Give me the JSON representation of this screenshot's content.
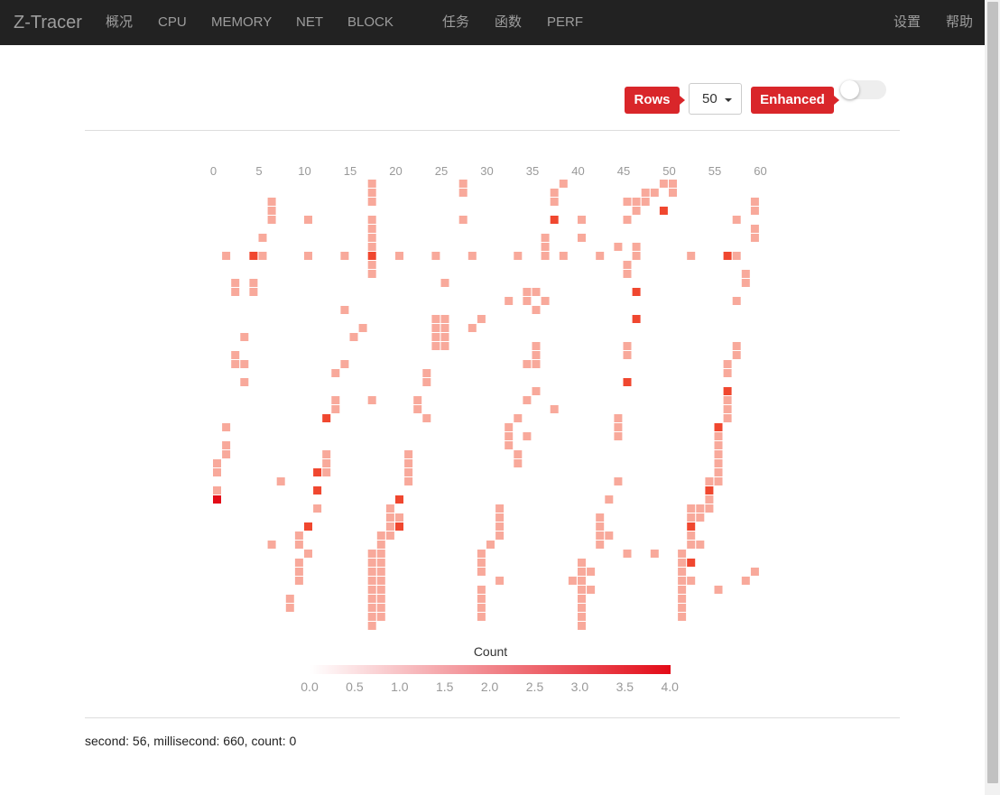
{
  "navbar": {
    "brand": "Z-Tracer",
    "items": [
      "概况",
      "CPU",
      "MEMORY",
      "NET",
      "BLOCK",
      "任务",
      "函数",
      "PERF"
    ],
    "right_items": [
      "设置",
      "帮助"
    ]
  },
  "controls": {
    "rows_label": "Rows",
    "rows_value": "50",
    "enhanced_label": "Enhanced",
    "enhanced_on": false
  },
  "chart_data": {
    "type": "heatmap",
    "x_ticks": [
      "0",
      "5",
      "10",
      "15",
      "20",
      "25",
      "30",
      "35",
      "40",
      "45",
      "50",
      "55",
      "60"
    ],
    "x_range": [
      0,
      60
    ],
    "rows": 50,
    "visual_map": {
      "title": "Count",
      "min": 0,
      "max": 4,
      "labels": [
        "0.0",
        "0.5",
        "1.0",
        "1.5",
        "2.0",
        "2.5",
        "3.0",
        "3.5",
        "4.0"
      ],
      "colors": [
        "#ffffff",
        "#e30b17"
      ]
    },
    "cells": [
      [
        0,
        31,
        1
      ],
      [
        0,
        32,
        1
      ],
      [
        0,
        34,
        1
      ],
      [
        0,
        35,
        4
      ],
      [
        1,
        27,
        1
      ],
      [
        1,
        29,
        1
      ],
      [
        1,
        30,
        1
      ],
      [
        1,
        8,
        1
      ],
      [
        2,
        11,
        1
      ],
      [
        2,
        12,
        1
      ],
      [
        2,
        19,
        1
      ],
      [
        2,
        20,
        1
      ],
      [
        3,
        17,
        1
      ],
      [
        3,
        20,
        1
      ],
      [
        3,
        22,
        1
      ],
      [
        4,
        8,
        2
      ],
      [
        4,
        11,
        1
      ],
      [
        4,
        12,
        1
      ],
      [
        5,
        8,
        1
      ],
      [
        5,
        6,
        1
      ],
      [
        6,
        2,
        1
      ],
      [
        6,
        3,
        1
      ],
      [
        6,
        4,
        1
      ],
      [
        6,
        40,
        1
      ],
      [
        7,
        33,
        1
      ],
      [
        8,
        46,
        1
      ],
      [
        8,
        47,
        1
      ],
      [
        9,
        42,
        1
      ],
      [
        9,
        43,
        1
      ],
      [
        9,
        44,
        1
      ],
      [
        9,
        39,
        1
      ],
      [
        9,
        40,
        1
      ],
      [
        10,
        38,
        2
      ],
      [
        10,
        41,
        1
      ],
      [
        10,
        4,
        1
      ],
      [
        10,
        8,
        1
      ],
      [
        11,
        32,
        2
      ],
      [
        11,
        34,
        2
      ],
      [
        11,
        36,
        1
      ],
      [
        12,
        26,
        2
      ],
      [
        12,
        30,
        1
      ],
      [
        12,
        31,
        1
      ],
      [
        12,
        32,
        1
      ],
      [
        13,
        21,
        1
      ],
      [
        13,
        24,
        1
      ],
      [
        13,
        25,
        1
      ],
      [
        14,
        20,
        1
      ],
      [
        14,
        14,
        1
      ],
      [
        14,
        8,
        1
      ],
      [
        15,
        17,
        1
      ],
      [
        16,
        16,
        1
      ],
      [
        17,
        0,
        1
      ],
      [
        17,
        1,
        1
      ],
      [
        17,
        2,
        1
      ],
      [
        17,
        4,
        1
      ],
      [
        17,
        5,
        1
      ],
      [
        17,
        6,
        1
      ],
      [
        17,
        7,
        1
      ],
      [
        17,
        8,
        2
      ],
      [
        17,
        9,
        1
      ],
      [
        17,
        10,
        1
      ],
      [
        17,
        24,
        1
      ],
      [
        17,
        41,
        1
      ],
      [
        17,
        42,
        1
      ],
      [
        17,
        43,
        1
      ],
      [
        17,
        44,
        1
      ],
      [
        17,
        45,
        1
      ],
      [
        17,
        46,
        1
      ],
      [
        17,
        47,
        1
      ],
      [
        17,
        48,
        1
      ],
      [
        17,
        49,
        1
      ],
      [
        18,
        39,
        1
      ],
      [
        18,
        40,
        1
      ],
      [
        18,
        41,
        1
      ],
      [
        18,
        42,
        1
      ],
      [
        18,
        43,
        1
      ],
      [
        18,
        44,
        1
      ],
      [
        18,
        45,
        1
      ],
      [
        18,
        46,
        1
      ],
      [
        18,
        47,
        1
      ],
      [
        18,
        48,
        1
      ],
      [
        19,
        38,
        1
      ],
      [
        19,
        36,
        1
      ],
      [
        19,
        37,
        1
      ],
      [
        19,
        39,
        1
      ],
      [
        20,
        35,
        2
      ],
      [
        20,
        37,
        1
      ],
      [
        20,
        38,
        2
      ],
      [
        20,
        8,
        1
      ],
      [
        21,
        30,
        1
      ],
      [
        21,
        31,
        1
      ],
      [
        21,
        32,
        1
      ],
      [
        21,
        33,
        1
      ],
      [
        22,
        25,
        1
      ],
      [
        22,
        24,
        1
      ],
      [
        23,
        22,
        1
      ],
      [
        23,
        21,
        1
      ],
      [
        23,
        26,
        1
      ],
      [
        24,
        8,
        1
      ],
      [
        24,
        15,
        1
      ],
      [
        24,
        16,
        1
      ],
      [
        24,
        17,
        1
      ],
      [
        24,
        18,
        1
      ],
      [
        25,
        11,
        1
      ],
      [
        25,
        15,
        1
      ],
      [
        25,
        16,
        1
      ],
      [
        25,
        17,
        1
      ],
      [
        25,
        18,
        1
      ],
      [
        27,
        0,
        1
      ],
      [
        27,
        1,
        1
      ],
      [
        27,
        4,
        1
      ],
      [
        28,
        8,
        1
      ],
      [
        28,
        16,
        1
      ],
      [
        29,
        15,
        1
      ],
      [
        29,
        41,
        1
      ],
      [
        29,
        42,
        1
      ],
      [
        29,
        43,
        1
      ],
      [
        29,
        45,
        1
      ],
      [
        29,
        46,
        1
      ],
      [
        29,
        47,
        1
      ],
      [
        29,
        48,
        1
      ],
      [
        30,
        40,
        1
      ],
      [
        31,
        39,
        1
      ],
      [
        31,
        44,
        1
      ],
      [
        31,
        36,
        1
      ],
      [
        31,
        37,
        1
      ],
      [
        31,
        38,
        1
      ],
      [
        32,
        13,
        1
      ],
      [
        32,
        27,
        1
      ],
      [
        32,
        28,
        1
      ],
      [
        32,
        29,
        1
      ],
      [
        33,
        8,
        1
      ],
      [
        33,
        26,
        1
      ],
      [
        33,
        30,
        1
      ],
      [
        33,
        31,
        1
      ],
      [
        34,
        12,
        1
      ],
      [
        34,
        13,
        1
      ],
      [
        34,
        20,
        1
      ],
      [
        34,
        24,
        1
      ],
      [
        34,
        28,
        1
      ],
      [
        35,
        12,
        1
      ],
      [
        35,
        18,
        1
      ],
      [
        35,
        19,
        1
      ],
      [
        35,
        20,
        1
      ],
      [
        35,
        23,
        1
      ],
      [
        35,
        14,
        1
      ],
      [
        36,
        6,
        1
      ],
      [
        36,
        7,
        1
      ],
      [
        36,
        8,
        1
      ],
      [
        36,
        13,
        1
      ],
      [
        37,
        1,
        1
      ],
      [
        37,
        2,
        1
      ],
      [
        37,
        4,
        2
      ],
      [
        37,
        25,
        1
      ],
      [
        38,
        0,
        1
      ],
      [
        38,
        8,
        1
      ],
      [
        39,
        44,
        1
      ],
      [
        40,
        4,
        1
      ],
      [
        40,
        6,
        1
      ],
      [
        40,
        42,
        1
      ],
      [
        40,
        43,
        1
      ],
      [
        40,
        44,
        1
      ],
      [
        40,
        45,
        1
      ],
      [
        40,
        46,
        1
      ],
      [
        40,
        47,
        1
      ],
      [
        40,
        48,
        1
      ],
      [
        40,
        49,
        1
      ],
      [
        40,
        43,
        1
      ],
      [
        41,
        43,
        1
      ],
      [
        41,
        45,
        1
      ],
      [
        42,
        8,
        1
      ],
      [
        42,
        37,
        1
      ],
      [
        42,
        38,
        1
      ],
      [
        42,
        39,
        1
      ],
      [
        42,
        40,
        1
      ],
      [
        43,
        35,
        1
      ],
      [
        43,
        39,
        1
      ],
      [
        44,
        7,
        1
      ],
      [
        44,
        26,
        1
      ],
      [
        44,
        27,
        1
      ],
      [
        44,
        28,
        1
      ],
      [
        44,
        33,
        1
      ],
      [
        45,
        22,
        2
      ],
      [
        45,
        18,
        1
      ],
      [
        45,
        19,
        1
      ],
      [
        45,
        2,
        1
      ],
      [
        45,
        4,
        1
      ],
      [
        45,
        9,
        1
      ],
      [
        45,
        10,
        1
      ],
      [
        45,
        41,
        1
      ],
      [
        46,
        2,
        1
      ],
      [
        46,
        3,
        1
      ],
      [
        46,
        7,
        1
      ],
      [
        46,
        8,
        1
      ],
      [
        46,
        12,
        2
      ],
      [
        46,
        15,
        2
      ],
      [
        46,
        3,
        1
      ],
      [
        47,
        1,
        1
      ],
      [
        47,
        2,
        1
      ],
      [
        48,
        1,
        1
      ],
      [
        48,
        41,
        1
      ],
      [
        49,
        3,
        2
      ],
      [
        49,
        0,
        1
      ],
      [
        50,
        0,
        1
      ],
      [
        50,
        1,
        1
      ],
      [
        51,
        41,
        1
      ],
      [
        51,
        42,
        1
      ],
      [
        51,
        43,
        1
      ],
      [
        51,
        44,
        1
      ],
      [
        51,
        45,
        1
      ],
      [
        51,
        46,
        1
      ],
      [
        51,
        47,
        1
      ],
      [
        51,
        48,
        1
      ],
      [
        52,
        8,
        1
      ],
      [
        52,
        36,
        1
      ],
      [
        52,
        37,
        1
      ],
      [
        52,
        38,
        2
      ],
      [
        52,
        39,
        1
      ],
      [
        52,
        40,
        1
      ],
      [
        52,
        42,
        2
      ],
      [
        52,
        44,
        1
      ],
      [
        53,
        37,
        1
      ],
      [
        53,
        36,
        1
      ],
      [
        53,
        40,
        1
      ],
      [
        54,
        33,
        1
      ],
      [
        54,
        34,
        2
      ],
      [
        54,
        35,
        1
      ],
      [
        54,
        36,
        1
      ],
      [
        55,
        28,
        1
      ],
      [
        55,
        29,
        1
      ],
      [
        55,
        30,
        1
      ],
      [
        55,
        31,
        1
      ],
      [
        55,
        32,
        1
      ],
      [
        55,
        33,
        1
      ],
      [
        55,
        27,
        2
      ],
      [
        55,
        45,
        1
      ],
      [
        56,
        23,
        2
      ],
      [
        56,
        24,
        1
      ],
      [
        56,
        25,
        1
      ],
      [
        56,
        26,
        1
      ],
      [
        56,
        20,
        1
      ],
      [
        56,
        21,
        1
      ],
      [
        56,
        8,
        2
      ],
      [
        57,
        4,
        1
      ],
      [
        57,
        8,
        1
      ],
      [
        57,
        13,
        1
      ],
      [
        57,
        19,
        1
      ],
      [
        57,
        18,
        1
      ],
      [
        58,
        10,
        1
      ],
      [
        58,
        11,
        1
      ],
      [
        58,
        44,
        1
      ],
      [
        59,
        5,
        1
      ],
      [
        59,
        6,
        1
      ],
      [
        59,
        3,
        1
      ],
      [
        59,
        43,
        1
      ],
      [
        59,
        2,
        1
      ]
    ]
  },
  "status": {
    "text": "second: 56, millisecond: 660, count: 0"
  }
}
